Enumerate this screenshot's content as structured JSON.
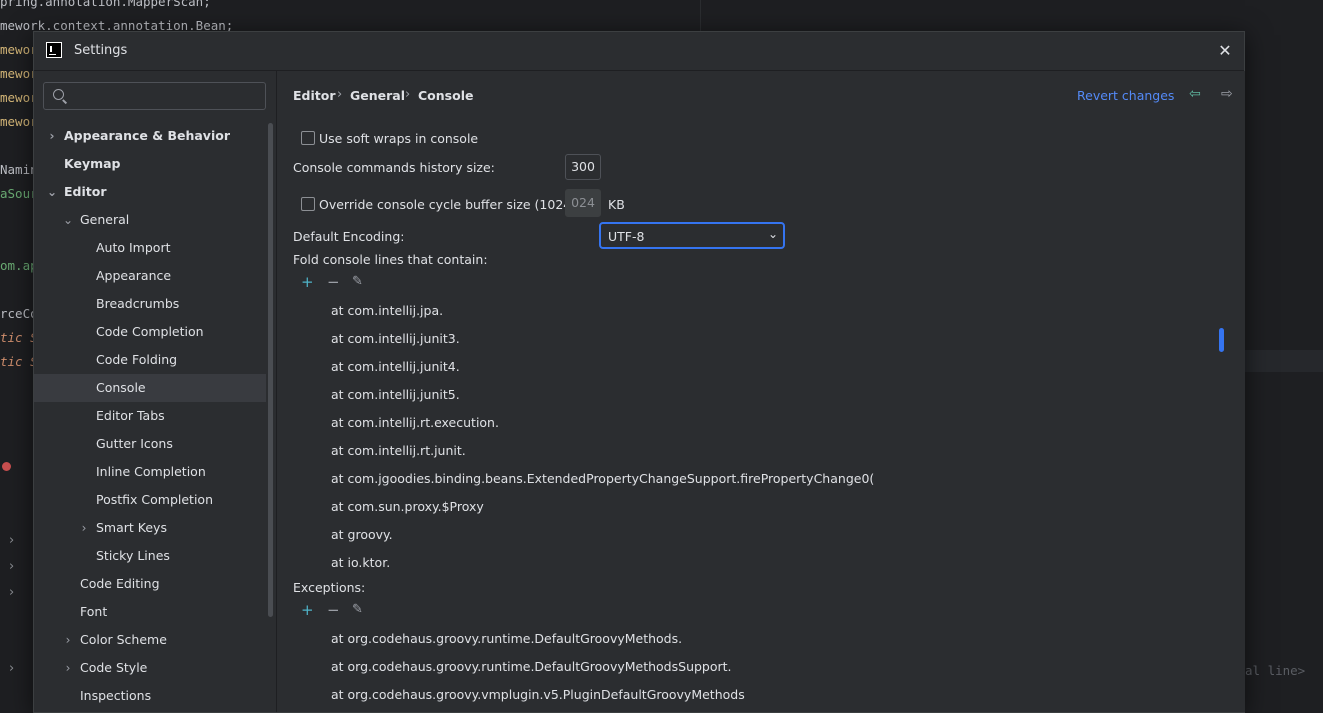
{
  "background_code": [
    {
      "text": "pring.annotation.MapperScan;",
      "color": "#bcbec4"
    },
    {
      "text": "mework.context.annotation.Bean;",
      "color": "#bcbec4"
    },
    {
      "text": "mewor",
      "color": "#d5b778"
    },
    {
      "text": "mewor",
      "color": "#d5b778"
    },
    {
      "text": "mewor",
      "color": "#d5b778"
    },
    {
      "text": "mewor",
      "color": "#d5b778"
    },
    {
      "text": "Namin",
      "color": "#bcbec4"
    },
    {
      "text": "aSour",
      "color": "#6aab73"
    },
    {
      "text": "om.ap",
      "color": "#6aab73"
    },
    {
      "text": "rceCo",
      "color": "#bcbec4"
    },
    {
      "text": "tic S",
      "color": "#cf8e6d"
    },
    {
      "text": "tic S",
      "color": "#cf8e6d"
    }
  ],
  "background_hint": "al line>",
  "dialog": {
    "title": "Settings"
  },
  "search": {
    "placeholder": ""
  },
  "tree": [
    {
      "label": "Appearance & Behavior",
      "level": 0,
      "bold": true,
      "chevron": "›",
      "selected": false
    },
    {
      "label": "Keymap",
      "level": 0,
      "bold": true,
      "chevron": "",
      "selected": false
    },
    {
      "label": "Editor",
      "level": 0,
      "bold": true,
      "chevron": "⌄",
      "selected": false
    },
    {
      "label": "General",
      "level": 1,
      "bold": false,
      "chevron": "⌄",
      "selected": false
    },
    {
      "label": "Auto Import",
      "level": 2,
      "bold": false,
      "chevron": "",
      "selected": false
    },
    {
      "label": "Appearance",
      "level": 2,
      "bold": false,
      "chevron": "",
      "selected": false
    },
    {
      "label": "Breadcrumbs",
      "level": 2,
      "bold": false,
      "chevron": "",
      "selected": false
    },
    {
      "label": "Code Completion",
      "level": 2,
      "bold": false,
      "chevron": "",
      "selected": false
    },
    {
      "label": "Code Folding",
      "level": 2,
      "bold": false,
      "chevron": "",
      "selected": false
    },
    {
      "label": "Console",
      "level": 2,
      "bold": false,
      "chevron": "",
      "selected": true
    },
    {
      "label": "Editor Tabs",
      "level": 2,
      "bold": false,
      "chevron": "",
      "selected": false
    },
    {
      "label": "Gutter Icons",
      "level": 2,
      "bold": false,
      "chevron": "",
      "selected": false
    },
    {
      "label": "Inline Completion",
      "level": 2,
      "bold": false,
      "chevron": "",
      "selected": false
    },
    {
      "label": "Postfix Completion",
      "level": 2,
      "bold": false,
      "chevron": "",
      "selected": false
    },
    {
      "label": "Smart Keys",
      "level": 2,
      "bold": false,
      "chevron": "›",
      "selected": false
    },
    {
      "label": "Sticky Lines",
      "level": 2,
      "bold": false,
      "chevron": "",
      "selected": false
    },
    {
      "label": "Code Editing",
      "level": 1,
      "bold": false,
      "chevron": "",
      "selected": false
    },
    {
      "label": "Font",
      "level": 1,
      "bold": false,
      "chevron": "",
      "selected": false
    },
    {
      "label": "Color Scheme",
      "level": 1,
      "bold": false,
      "chevron": "›",
      "selected": false
    },
    {
      "label": "Code Style",
      "level": 1,
      "bold": false,
      "chevron": "›",
      "selected": false
    },
    {
      "label": "Inspections",
      "level": 1,
      "bold": false,
      "chevron": "",
      "selected": false
    }
  ],
  "breadcrumb": {
    "items": [
      "Editor",
      "General",
      "Console"
    ],
    "separator": "›"
  },
  "revert_label": "Revert changes",
  "soft_wraps_label": "Use soft wraps in console",
  "history_label": "Console commands history size:",
  "history_value": "300",
  "override_label": "Override console cycle buffer size (1024 KB)",
  "override_value": "024",
  "override_unit": "KB",
  "encoding_label": "Default Encoding:",
  "encoding_value": "UTF-8",
  "fold_label": "Fold console lines that contain:",
  "fold_items": [
    "at com.intellij.jpa.",
    "at com.intellij.junit3.",
    "at com.intellij.junit4.",
    "at com.intellij.junit5.",
    "at com.intellij.rt.execution.",
    "at com.intellij.rt.junit.",
    "at com.jgoodies.binding.beans.ExtendedPropertyChangeSupport.firePropertyChange0(",
    "at com.sun.proxy.$Proxy",
    "at groovy.",
    "at io.ktor."
  ],
  "exceptions_label": "Exceptions:",
  "exception_items": [
    "at org.codehaus.groovy.runtime.DefaultGroovyMethods.",
    "at org.codehaus.groovy.runtime.DefaultGroovyMethodsSupport.",
    "at org.codehaus.groovy.vmplugin.v5.PluginDefaultGroovyMethods"
  ],
  "icons": {
    "plus": "+",
    "minus": "−",
    "pencil": "✎",
    "close": "✕",
    "back": "⇦",
    "forward": "⇨",
    "dropdown": "⌄"
  }
}
